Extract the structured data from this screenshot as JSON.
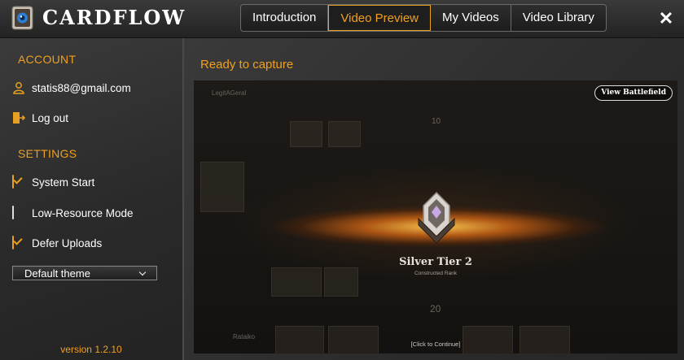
{
  "app": {
    "title": "CARDFLOW"
  },
  "tabs": [
    {
      "label": "Introduction",
      "active": false
    },
    {
      "label": "Video Preview",
      "active": true
    },
    {
      "label": "My Videos",
      "active": false
    },
    {
      "label": "Video Library",
      "active": false
    }
  ],
  "window": {
    "close_icon": "close-icon"
  },
  "sidebar": {
    "account_title": "ACCOUNT",
    "email": "statis88@gmail.com",
    "logout_label": "Log out",
    "settings_title": "SETTINGS",
    "settings": [
      {
        "label": "System Start",
        "checked": true
      },
      {
        "label": "Low-Resource Mode",
        "checked": false
      },
      {
        "label": "Defer Uploads",
        "checked": true
      }
    ],
    "theme_value": "Default theme",
    "version": "version 1.2.10"
  },
  "main": {
    "status": "Ready to capture",
    "preview": {
      "view_button": "View Battlefield",
      "rank_title": "Silver Tier 2",
      "rank_subtitle": "Constructed Rank",
      "continue_text": "[Click to Continue]",
      "player_top_name": "LegitAGeral",
      "player_bottom_name": "Rataiko",
      "life_top": "10",
      "life_bottom": "20"
    }
  },
  "colors": {
    "accent": "#f0a020",
    "background": "#2a2a2a"
  }
}
